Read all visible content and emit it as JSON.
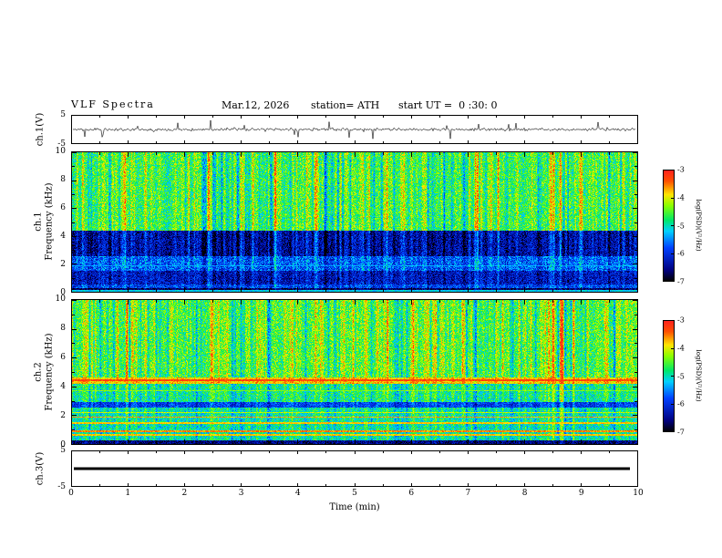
{
  "figure": {
    "title": "VLF Spectra",
    "date": "Mar.12, 2026",
    "station_label": "station= ATH",
    "start_ut_label": "start UT =  0 :30: 0"
  },
  "xaxis": {
    "label": "Time (min)",
    "min": 0,
    "max": 10,
    "ticks": [
      0,
      1,
      2,
      3,
      4,
      5,
      6,
      7,
      8,
      9,
      10
    ]
  },
  "colorbar": {
    "label": "log(PSD)(V²/Hz)",
    "ticks": [
      -3,
      -4,
      -5,
      -6,
      -7
    ]
  },
  "colormap": {
    "vmin": -7,
    "vmax": -3,
    "stops": [
      {
        "t": 0.0,
        "c": "#000000"
      },
      {
        "t": 0.1,
        "c": "#00007f"
      },
      {
        "t": 0.3,
        "c": "#0040ff"
      },
      {
        "t": 0.45,
        "c": "#00d0ff"
      },
      {
        "t": 0.55,
        "c": "#00e868"
      },
      {
        "t": 0.68,
        "c": "#8aff00"
      },
      {
        "t": 0.78,
        "c": "#ffe400"
      },
      {
        "t": 0.9,
        "c": "#ff5000"
      },
      {
        "t": 1.0,
        "c": "#ff2020"
      }
    ]
  },
  "chart_data": [
    {
      "type": "line",
      "panel": "ch1_waveform",
      "ylabel": "ch.1(V)",
      "ylim": [
        -5,
        5
      ],
      "yticks": [
        5,
        -5
      ],
      "signal": {
        "seed": 11,
        "noise_amp": 0.55,
        "spike_prob": 0.05,
        "spike_amp": 3.2
      },
      "description": "Channel-1 broadband VLF waveform fluctuating around 0 V with dense impulsive sferic spikes reaching roughly ±4 V over the 10-minute record"
    },
    {
      "type": "heatmap",
      "panel": "ch1_spectrogram",
      "ylabel_line1": "ch.1",
      "ylabel_line2": "Frequency (kHz)",
      "ylim": [
        0,
        10
      ],
      "yticks": [
        0,
        2,
        4,
        6,
        8,
        10
      ],
      "xlim": [
        0,
        10
      ],
      "value_range": [
        -7,
        -3
      ],
      "seed": 23,
      "bands": [
        {
          "f": [
            0,
            0.35
          ],
          "base": -6.7,
          "noise": 0.35,
          "streak_gain": 0.3
        },
        {
          "f": [
            0.35,
            0.6
          ],
          "base": -5.9,
          "noise": 0.5,
          "streak_gain": 0.4
        },
        {
          "f": [
            0.6,
            1.55
          ],
          "base": -6.3,
          "noise": 0.5,
          "streak_gain": 0.5
        },
        {
          "f": [
            1.55,
            2.6
          ],
          "base": -5.75,
          "noise": 0.55,
          "streak_gain": 0.5
        },
        {
          "f": [
            2.6,
            4.4
          ],
          "base": -6.45,
          "noise": 0.5,
          "streak_gain": 0.8
        },
        {
          "f": [
            4.4,
            10.01
          ],
          "base": -4.7,
          "noise": 0.55,
          "streak_gain": 0.9
        }
      ],
      "lines": [
        {
          "f": 0.12,
          "level": -5.2,
          "w": 0.05
        },
        {
          "f": 1.9,
          "level": -5.4,
          "w": 0.04
        }
      ],
      "description": "Channel-1 VLF spectrogram 0–10 kHz: energetic green/yellow band above ~4.5 kHz crossed by red vertical sferic streaks, dark blue 2.6–4.4 kHz region with vertical striations, cyan/blue structured bands below 2.6 kHz, PSD color scale -7 to -3"
    },
    {
      "type": "heatmap",
      "panel": "ch2_spectrogram",
      "ylabel_line1": "ch.2",
      "ylabel_line2": "Frequency (kHz)",
      "ylim": [
        0,
        10
      ],
      "yticks": [
        0,
        2,
        4,
        6,
        8,
        10
      ],
      "xlim": [
        0,
        10
      ],
      "value_range": [
        -7,
        -3
      ],
      "seed": 57,
      "bands": [
        {
          "f": [
            0,
            0.3
          ],
          "base": -6.6,
          "noise": 0.4,
          "streak_gain": 0.3
        },
        {
          "f": [
            0.3,
            2.55
          ],
          "base": -5.0,
          "noise": 0.5,
          "streak_gain": 0.5
        },
        {
          "f": [
            2.55,
            2.95
          ],
          "base": -5.9,
          "noise": 0.4,
          "streak_gain": 0.4
        },
        {
          "f": [
            2.95,
            4.2
          ],
          "base": -4.9,
          "noise": 0.5,
          "streak_gain": 0.6
        },
        {
          "f": [
            4.2,
            4.65
          ],
          "base": -3.8,
          "noise": 0.35,
          "streak_gain": 0.3
        },
        {
          "f": [
            4.65,
            10.01
          ],
          "base": -4.6,
          "noise": 0.55,
          "streak_gain": 0.9
        }
      ],
      "lines": [
        {
          "f": 0.7,
          "level": -3.8,
          "w": 0.05
        },
        {
          "f": 0.95,
          "level": -3.6,
          "w": 0.05
        },
        {
          "f": 1.5,
          "level": -3.8,
          "w": 0.05
        },
        {
          "f": 1.9,
          "level": -3.7,
          "w": 0.05
        },
        {
          "f": 2.2,
          "level": -4.1,
          "w": 0.04
        },
        {
          "f": 3.7,
          "level": -4.3,
          "w": 0.04
        },
        {
          "f": 4.42,
          "level": -3.3,
          "w": 0.07
        }
      ],
      "description": "Channel-2 VLF spectrogram 0–10 kHz: green/yellow background with red vertical sferic streaks above ~4.6 kHz, strong orange horizontal band at 4.2–4.65 kHz, multiple narrow orange power-line harmonic lines between 0.7 and 2.2 kHz, darker band near 2.6–2.95 kHz, black band at 0 kHz"
    },
    {
      "type": "line",
      "panel": "ch3_waveform",
      "ylabel": "ch.3(V)",
      "ylim": [
        -5,
        5
      ],
      "yticks": [
        5,
        -5
      ],
      "flat_value": 0,
      "description": "Channel 3 is flat at 0 V (no signal): a thick solid black horizontal line across the full 10-minute interval"
    }
  ]
}
